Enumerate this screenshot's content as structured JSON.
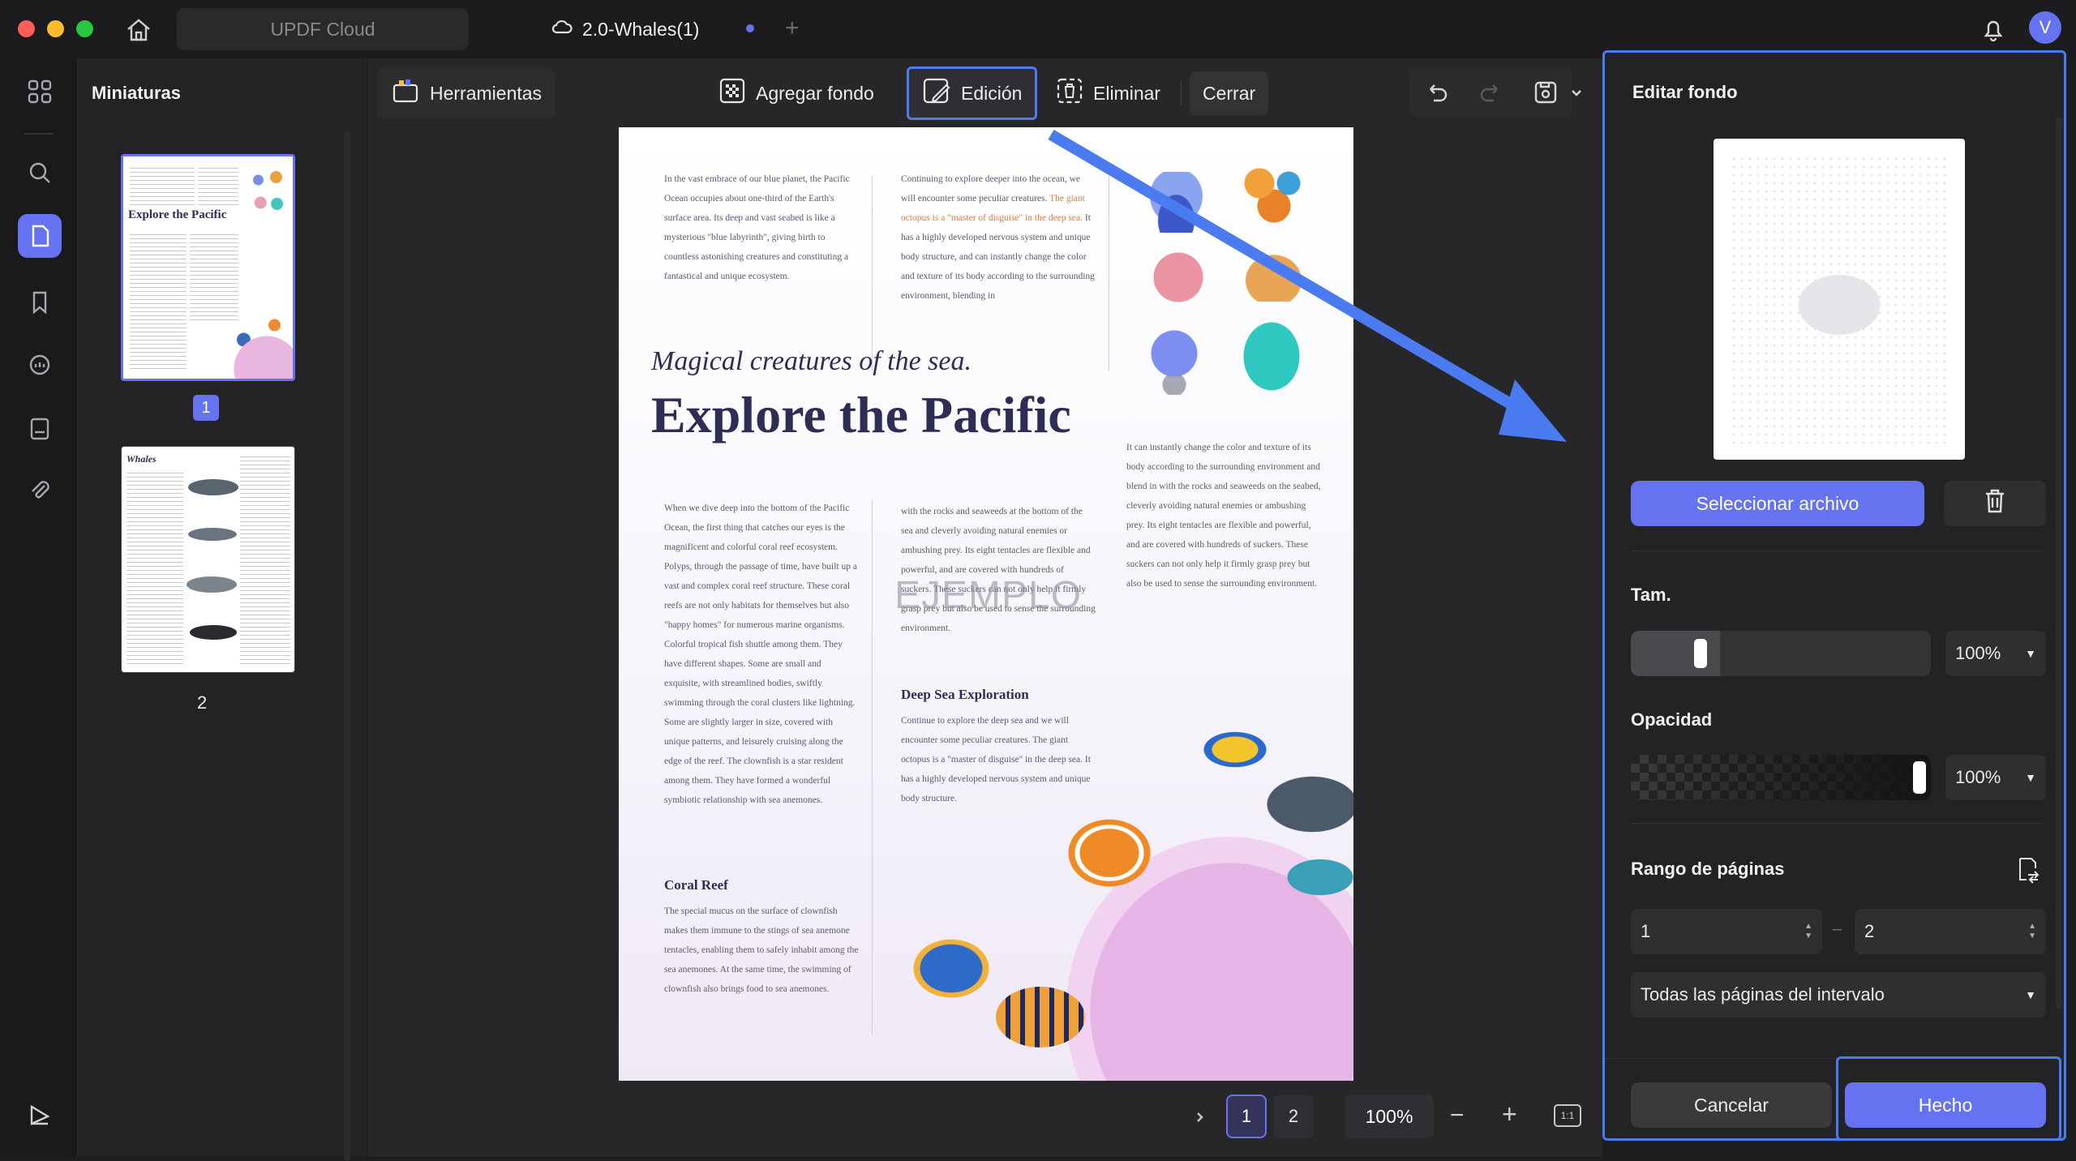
{
  "window": {
    "cloud_tab": "UPDF Cloud",
    "doc_tab": "2.0-Whales(1)",
    "avatar": "V"
  },
  "sidebar": {
    "title": "Miniaturas",
    "pages": [
      "1",
      "2"
    ]
  },
  "toolbar": {
    "tools": "Herramientas",
    "add_background": "Agregar fondo",
    "edit": "Edición",
    "delete": "Eliminar",
    "close": "Cerrar"
  },
  "document": {
    "watermark": "EJEMPLO",
    "subtitle": "Magical creatures of the sea.",
    "title": "Explore the Pacific",
    "col1_top": "In the vast embrace of our blue planet, the Pacific Ocean occupies about one-third of the Earth's surface area. Its deep and vast seabed is like a mysterious \"blue labyrinth\", giving birth to countless astonishing creatures and constituting a fantastical and unique ecosystem.",
    "col2_top_a": "Continuing to explore deeper into the ocean, we will encounter some peculiar creatures.",
    "col2_top_highlight": "The giant octopus is a \"master of disguise\" in the deep sea.",
    "col2_top_b": "It has a highly developed nervous system and unique body structure, and can instantly change the color and texture of its body according to the surrounding environment, blending in",
    "col3_mid": "It can instantly change the color and texture of its body according to the surrounding environment and blend in with the rocks and seaweeds on the seabed, cleverly avoiding natural enemies or ambushing prey. Its eight tentacles are flexible and powerful, and are covered with hundreds of suckers. These suckers can not only help it firmly grasp prey but also be used to sense the surrounding environment.",
    "col1_body": "When we dive deep into the bottom of the Pacific Ocean, the first thing that catches our eyes is the magnificent and colorful coral reef ecosystem. Polyps, through the passage of time, have built up a vast and complex coral reef structure. These coral reefs are not only habitats for themselves but also \"happy homes\" for numerous marine organisms. Colorful tropical fish shuttle among them. They have different shapes. Some are small and exquisite, with streamlined bodies, swiftly swimming through the coral clusters like lightning. Some are slightly larger in size, covered with unique patterns, and leisurely cruising along the edge of the reef. The clownfish is a star resident among them. They have formed a wonderful symbiotic relationship with sea anemones.",
    "col2_body": "with the rocks and seaweeds at the bottom of the sea and cleverly avoiding natural enemies or ambushing prey. Its eight tentacles are flexible and powerful, and are covered with hundreds of suckers. These suckers can not only help it firmly grasp prey but also be used to sense the surrounding environment.",
    "deep_sea_heading": "Deep Sea Exploration",
    "deep_sea_body": "Continue to explore the deep sea and we will encounter some peculiar creatures. The giant octopus is a \"master of disguise\" in the deep sea. It has a highly developed nervous system and unique body structure.",
    "coral_heading": "Coral Reef",
    "coral_body": "The special mucus on the surface of clownfish makes them immune to the stings of sea anemone tentacles, enabling them to safely inhabit among the sea anemones. At the same time, the swimming of clownfish also brings food to sea anemones."
  },
  "thumb2_title": "Whales",
  "bottom_bar": {
    "page1": "1",
    "page2": "2",
    "zoom": "100%",
    "fit": "1:1"
  },
  "panel": {
    "title": "Editar fondo",
    "select_file": "Seleccionar archivo",
    "size_label": "Tam.",
    "size_value": "100%",
    "opacity_label": "Opacidad",
    "opacity_value": "100%",
    "range_label": "Rango de páginas",
    "range_from": "1",
    "range_sep": "–",
    "range_to": "2",
    "range_mode": "Todas las páginas del intervalo",
    "cancel": "Cancelar",
    "done": "Hecho"
  },
  "colors": {
    "accent": "#6673f0",
    "highlight_border": "#4a7bf0",
    "title_text": "#2d2d55",
    "highlight_text": "#e8793a"
  }
}
